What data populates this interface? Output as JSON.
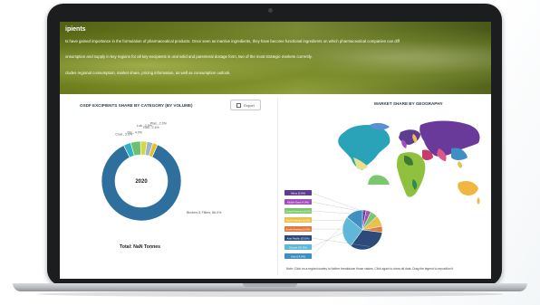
{
  "hero": {
    "title": "ipients",
    "line1": "ts have gained importance in the formulation of pharmaceutical products. Once seen as inactive ingredients, they have become functional ingredients on which pharmaceutical companies can diff",
    "line2": "onsumption and supply in key regions for all key excipients in oral solid and parenteral dosage form, two of the most strategic markets currently.",
    "line3": "cludes regional consumption, market share, pricing information, as well as consumption outlook."
  },
  "left_panel": {
    "title": "OSDF EXCIPIENTS SHARE BY CATEGORY (BY VOLUME)",
    "export_label": "Export",
    "center_label": "2020",
    "total_label": "Total: NaN Tonnes"
  },
  "right_panel": {
    "title": "MARKET SHARE BY GEOGRAPHY",
    "note": "Note: Click on a region/country to further breakdown those values. Click again to show all data. Drag the legend to reposition it"
  },
  "colors": {
    "donut_main": "#2e6f9e",
    "accent_yellow": "#e3c12c",
    "accent_green": "#6fbf73",
    "accent_teal": "#31b0c6"
  },
  "chart_data": [
    {
      "type": "pie",
      "title": "OSDF EXCIPIENTS SHARE BY CATEGORY (BY VOLUME)",
      "center_text": "2020",
      "slices": [
        {
          "name": "Binders & Fillers",
          "value": 86.0,
          "label": "Binders & Fillers, 86.0%",
          "color": "#2e6f9e"
        },
        {
          "name": "Coat.",
          "value": 3.0,
          "label": "Coat., 3.0%",
          "color": "#31b0c6"
        },
        {
          "name": "Dis.",
          "value": 4.0,
          "label": "Dis., 4.0%",
          "color": "#6fbf73"
        },
        {
          "name": "Lub.",
          "value": 2.6,
          "label": "Lub., 2.6%",
          "color": "#cfd94a"
        },
        {
          "name": "Glid.",
          "value": 2.4,
          "label": "Glid., 2.4%",
          "color": "#9fb4c8"
        },
        {
          "name": "Plas.",
          "value": 2.0,
          "label": "Plas., 2.0%",
          "color": "#e3c12c"
        }
      ],
      "legend": "none"
    },
    {
      "type": "pie",
      "title": "MARKET SHARE BY GEOGRAPHY",
      "slices": [
        {
          "name": "Africa",
          "value": 3.0,
          "label": "Africa (3.0%)",
          "color": "#5c3d8f"
        },
        {
          "name": "Middle East",
          "value": 4.0,
          "label": "Middle East (4.0%)",
          "color": "#a34ec0"
        },
        {
          "name": "Central America",
          "value": 6.0,
          "label": "Central America (6.0%)",
          "color": "#7bc86c"
        },
        {
          "name": "North America",
          "value": 9.0,
          "label": "North America (9.0%)",
          "color": "#e8c24a"
        },
        {
          "name": "South America",
          "value": 5.0,
          "label": "South America (5.0%)",
          "color": "#e07a3b"
        },
        {
          "name": "Asia Pacific",
          "value": 33.0,
          "label": "Asia Pacific (33.0%)",
          "color": "#2c4a7a"
        },
        {
          "name": "Europe",
          "value": 26.0,
          "label": "Europe (26.0%)",
          "color": "#5fb8d7"
        },
        {
          "name": "Asia",
          "value": 14.0,
          "label": "Asia (14.0%)",
          "color": "#3f8fc2"
        }
      ],
      "legend": "left"
    }
  ]
}
